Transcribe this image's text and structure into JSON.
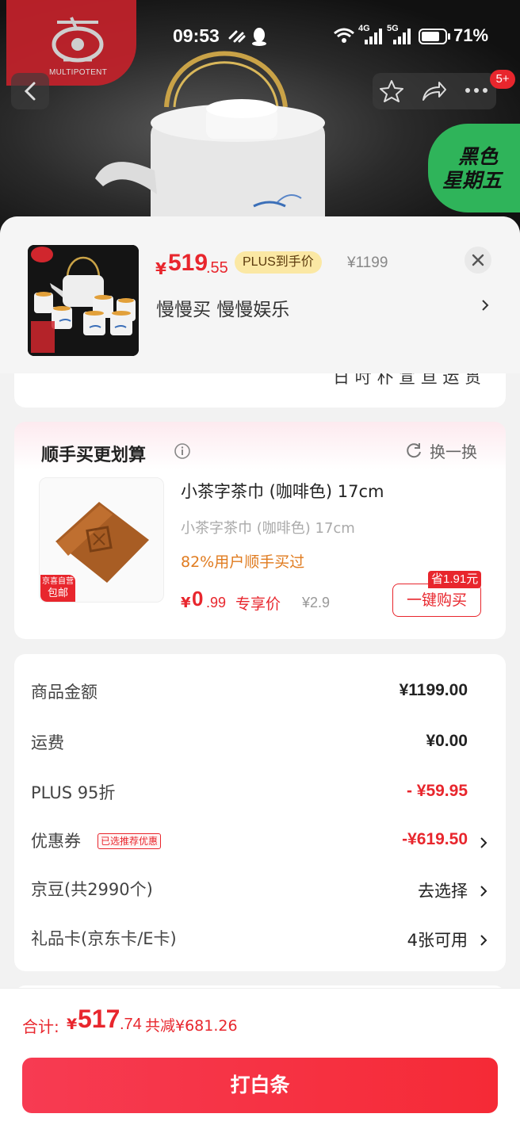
{
  "status_bar": {
    "time": "09:53",
    "battery_pct": "71%",
    "signal_4g": "4G",
    "signal_5g": "5G"
  },
  "brand": {
    "logo_text": "MULTIPOTENT"
  },
  "promo_badge": {
    "line1": "黑色",
    "line2": "星期五"
  },
  "nav": {
    "notification_count": "5+"
  },
  "product": {
    "price_symbol": "¥",
    "price_int": "519",
    "price_dec": ".55",
    "plus_tag": "PLUS到手价",
    "original_price": "¥1199",
    "subtitle": "慢慢买  慢慢娱乐"
  },
  "clipped_card": {
    "text": "日 吋 朴 宣 亘 运 贯"
  },
  "addon": {
    "section_title": "顺手买更划算",
    "swap_label": "换一换",
    "item_name": "小茶字茶巾 (咖啡色) 17cm",
    "item_spec": "小茶字茶巾 (咖啡色) 17cm",
    "buyers_text": "82%用户顺手买过",
    "price_symbol": "¥",
    "price_int": "0",
    "price_dec": ".99",
    "exclusive_label": "专享价",
    "original_price": "¥2.9",
    "buy_button": "一键购买",
    "save_tag": "省1.91元",
    "badge_line1": "京喜自营",
    "badge_line2": "包邮"
  },
  "summary": {
    "rows": [
      {
        "label": "商品金额",
        "value": "¥1199.00"
      },
      {
        "label": "运费",
        "value": "¥0.00"
      },
      {
        "label": "PLUS 95折",
        "value": "- ¥59.95"
      },
      {
        "label": "优惠券",
        "value": "-¥619.50",
        "tag": "已选推荐优惠"
      },
      {
        "label": "京豆(共2990个)",
        "value": "去选择"
      },
      {
        "label": "礼品卡(京东卡/E卡)",
        "value": "4张可用"
      }
    ]
  },
  "footer": {
    "total_label": "合计:",
    "total_symbol": "¥",
    "total_int": "517",
    "total_dec": ".74",
    "total_saved": "共减¥681.26",
    "pay_button": "打白条"
  },
  "colors": {
    "accent_red": "#e8262d",
    "plus_gold": "#fbe8a4",
    "promo_green": "#2fb45a"
  }
}
